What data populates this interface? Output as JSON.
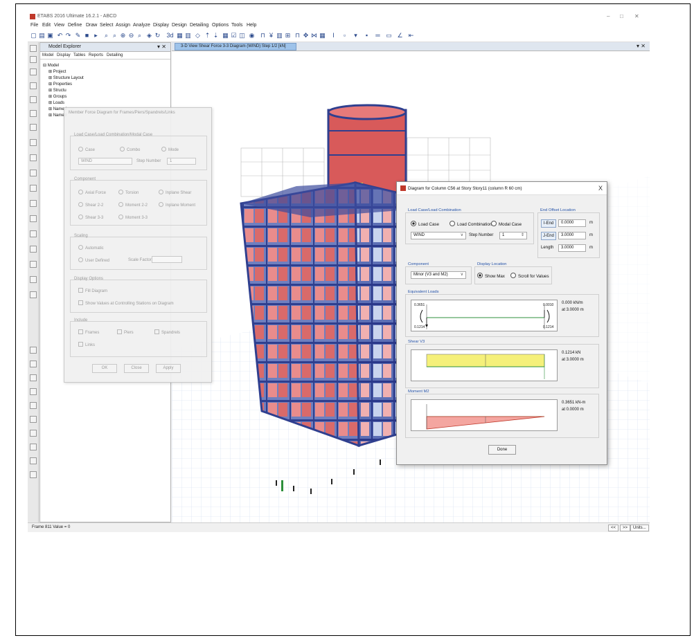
{
  "app": {
    "title": "ETABS 2016 Ultimate 16.2.1 - ABCD",
    "window_controls": [
      "–",
      "□",
      "✕"
    ],
    "menu": [
      "File",
      "Edit",
      "View",
      "Define",
      "Draw",
      "Select",
      "Assign",
      "Analyze",
      "Display",
      "Design",
      "Detailing",
      "Options",
      "Tools",
      "Help"
    ]
  },
  "explorer": {
    "title": "Model Explorer",
    "close": "▾ ✕",
    "tabs": [
      "Model",
      "Display",
      "Tables",
      "Reports",
      "Detailing"
    ],
    "tree": [
      "⊟ Model",
      "⊞ Project",
      "⊞ Structure Layout",
      "⊞ Properties",
      "⊞ Structu",
      "⊞ Groups",
      "⊞ Loads",
      "⊞ Named",
      "⊞ Named"
    ]
  },
  "view_tab": {
    "label": "3-D View   Shear Force 3-3 Diagram   (WIND)  Step 1/2  [kN]",
    "close": "▾ ✕"
  },
  "member_dialog": {
    "title": "Member Force Diagram for Frames/Piers/Spandrels/Links",
    "load_group": "Load Case/Load Combination/Modal Case",
    "radios_type": [
      "Case",
      "Combo",
      "Mode"
    ],
    "case_value": "WIND",
    "step_label": "Step Number",
    "step_value": "1",
    "component_group": "Component",
    "components": [
      "Axial Force",
      "Torsion",
      "Inplane Shear",
      "Shear 2-2",
      "Moment 2-2",
      "Inplane Moment",
      "Shear 3-3",
      "Moment 3-3"
    ],
    "scaling_group": "Scaling",
    "scaling": [
      "Automatic",
      "User Defined"
    ],
    "scale_factor_label": "Scale Factor",
    "display_group": "Display Options",
    "display_opts": [
      "Fill Diagram",
      "Show Values at Controlling Stations on Diagram"
    ],
    "include_group": "Include",
    "include": [
      "Frames",
      "Piers",
      "Spandrels",
      "Links"
    ],
    "buttons": [
      "OK",
      "Close",
      "Apply"
    ]
  },
  "column_dialog": {
    "title": "Diagram for Column C56 at Story Story11 (column R 60 cm)",
    "close": "X",
    "load_group": "Load Case/Load Combination",
    "radios": [
      "Load Case",
      "Load Combination",
      "Modal Case"
    ],
    "case_value": "WIND",
    "step_label": "Step Number",
    "step_value": "1",
    "end_offset_group": "End Offset Location",
    "i_end_label": "I-End",
    "i_end_value": "0.0000",
    "j_end_label": "J-End",
    "j_end_value": "3.0000",
    "length_label": "Length",
    "length_value": "3.0000",
    "unit_m": "m",
    "component_group": "Component",
    "component_value": "Minor (V3 and M2)",
    "display_group": "Display Location",
    "display_radios": [
      "Show Max",
      "Scroll for Values"
    ],
    "equiv_group": "Equivalent Loads",
    "equiv_left_top": "0.3651",
    "equiv_left_bottom": "0.1214",
    "equiv_right_top": "0.0010",
    "equiv_right_bottom": "0.1214",
    "equiv_value": "0.000 kN/m",
    "equiv_at": "at 3.0000 m",
    "shear_group": "Shear V3",
    "shear_value": "0.1214 kN",
    "shear_at": "at 3.0000 m",
    "moment_group": "Moment M2",
    "moment_value": "0.3651 kN-m",
    "moment_at": "at 0.0000 m",
    "done": "Done"
  },
  "status": {
    "text": "Frame 811  Value = 0",
    "buttons": [
      "<<",
      ">>",
      "Units..."
    ]
  },
  "colors": {
    "accent_blue": "#2452a8",
    "shear_fill": "#f5f07a",
    "moment_fill": "#f4a6a0",
    "frame_blue": "#2f3f8f",
    "panel_red": "#e36b6b"
  }
}
